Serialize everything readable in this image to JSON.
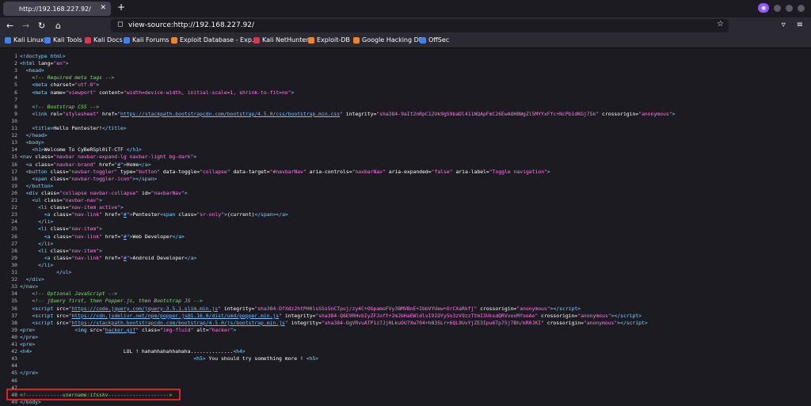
{
  "tab": {
    "title": "http://192.168.227.92/"
  },
  "url": "view-source:http://192.168.227.92/",
  "bookmarks": [
    "Kali Linux",
    "Kali Tools",
    "Kali Docs",
    "Kali Forums",
    "Exploit Database - Exp...",
    "Kali NetHunter",
    "Exploit-DB",
    "Google Hacking DB",
    "OffSec"
  ],
  "source_lines": [
    {
      "n": "1",
      "html": "<span class=\"t\">&lt;!doctype html&gt;</span>"
    },
    {
      "n": "2",
      "html": "<span class=\"t\">&lt;html</span> <span class=\"a\">lang</span>=<span class=\"v\">\"en\"</span><span class=\"t\">&gt;</span>"
    },
    {
      "n": "3",
      "html": "  <span class=\"t\">&lt;head&gt;</span>"
    },
    {
      "n": "4",
      "html": "    <span class=\"c\">&lt;!-- Required meta tags --&gt;</span>"
    },
    {
      "n": "5",
      "html": "    <span class=\"t\">&lt;meta</span> <span class=\"a\">charset</span>=<span class=\"v\">\"utf-8\"</span><span class=\"t\">&gt;</span>"
    },
    {
      "n": "6",
      "html": "    <span class=\"t\">&lt;meta</span> <span class=\"a\">name</span>=<span class=\"v\">\"viewport\"</span> <span class=\"a\">content</span>=<span class=\"v\">\"width=device-width, initial-scale=1, shrink-to-fit=no\"</span><span class=\"t\">&gt;</span>"
    },
    {
      "n": "7",
      "html": ""
    },
    {
      "n": "8",
      "html": "    <span class=\"c\">&lt;!-- Bootstrap CSS --&gt;</span>"
    },
    {
      "n": "9",
      "html": "    <span class=\"t\">&lt;link</span> <span class=\"a\">rel</span>=<span class=\"v\">\"stylesheet\"</span> <span class=\"a\">href</span>=<span class=\"v\">\"</span><span class=\"l\">https://stackpath.bootstrapcdn.com/bootstrap/4.5.0/css/bootstrap.min.css</span><span class=\"v\">\"</span> <span class=\"a\">integrity</span>=<span class=\"v\">\"sha384-9aIt2nRpC12Uk9gS9baDl411NQApFmC26EwAOH8WgZl5MYYxFfc+NcPb1dKGj7Sk\"</span> <span class=\"a\">crossorigin</span>=<span class=\"v\">\"anonymous\"</span><span class=\"t\">&gt;</span>"
    },
    {
      "n": "10",
      "html": ""
    },
    {
      "n": "11",
      "html": "    <span class=\"t\">&lt;title&gt;</span>Hello Pentester!<span class=\"t\">&lt;/title&gt;</span>"
    },
    {
      "n": "12",
      "html": "  <span class=\"t\">&lt;/head&gt;</span>"
    },
    {
      "n": "13",
      "html": "  <span class=\"t\">&lt;body&gt;</span>"
    },
    {
      "n": "14",
      "html": "    <span class=\"t\">&lt;h1&gt;</span>Welcome To CyBeRSpl0iT-CTF <span class=\"t\">&lt;/h1&gt;</span>"
    },
    {
      "n": "15",
      "html": "<span class=\"t\">&lt;nav</span> <span class=\"a\">class</span>=<span class=\"v\">\"navbar navbar-expand-lg navbar-light bg-dark\"</span><span class=\"t\">&gt;</span>"
    },
    {
      "n": "16",
      "html": "  <span class=\"t\">&lt;a</span> <span class=\"a\">class</span>=<span class=\"v\">\"navbar-brand\"</span> <span class=\"a\">href</span>=<span class=\"v\">\"</span><span class=\"l\">#</span><span class=\"v\">\"</span><span class=\"t\">&gt;</span>Home<span class=\"t\">&lt;/a&gt;</span>"
    },
    {
      "n": "17",
      "html": "  <span class=\"t\">&lt;button</span> <span class=\"a\">class</span>=<span class=\"v\">\"navbar-toggler\"</span> <span class=\"a\">type</span>=<span class=\"v\">\"button\"</span> <span class=\"a\">data-toggle</span>=<span class=\"v\">\"collapse\"</span> <span class=\"a\">data-target</span>=<span class=\"v\">\"#navbarNav\"</span> <span class=\"a\">aria-controls</span>=<span class=\"v\">\"navbarNav\"</span> <span class=\"a\">aria-expanded</span>=<span class=\"v\">\"false\"</span> <span class=\"a\">aria-label</span>=<span class=\"v\">\"Toggle navigation\"</span><span class=\"t\">&gt;</span>"
    },
    {
      "n": "18",
      "html": "    <span class=\"t\">&lt;span</span> <span class=\"a\">class</span>=<span class=\"v\">\"navbar-toggler-icon\"</span><span class=\"t\">&gt;&lt;/span&gt;</span>"
    },
    {
      "n": "19",
      "html": "  <span class=\"t\">&lt;/button&gt;</span>"
    },
    {
      "n": "20",
      "html": "  <span class=\"t\">&lt;div</span> <span class=\"a\">class</span>=<span class=\"v\">\"collapse navbar-collapse\"</span> <span class=\"a\">id</span>=<span class=\"v\">\"navbarNav\"</span><span class=\"t\">&gt;</span>"
    },
    {
      "n": "21",
      "html": "    <span class=\"t\">&lt;ul</span> <span class=\"a\">class</span>=<span class=\"v\">\"navbar-nav\"</span><span class=\"t\">&gt;</span>"
    },
    {
      "n": "22",
      "html": "      <span class=\"t\">&lt;li</span> <span class=\"a\">class</span>=<span class=\"v\">\"nav-item active\"</span><span class=\"t\">&gt;</span>"
    },
    {
      "n": "23",
      "html": "        <span class=\"t\">&lt;a</span> <span class=\"a\">class</span>=<span class=\"v\">\"nav-link\"</span> <span class=\"a\">href</span>=<span class=\"v\">\"</span><span class=\"l\">#</span><span class=\"v\">\"</span><span class=\"t\">&gt;</span>Pentester<span class=\"t\">&lt;span</span> <span class=\"a\">class</span>=<span class=\"v\">\"sr-only\"</span><span class=\"t\">&gt;</span>(current)<span class=\"t\">&lt;/span&gt;&lt;/a&gt;</span>"
    },
    {
      "n": "24",
      "html": "      <span class=\"t\">&lt;/li&gt;</span>"
    },
    {
      "n": "25",
      "html": "      <span class=\"t\">&lt;li</span> <span class=\"a\">class</span>=<span class=\"v\">\"nav-item\"</span><span class=\"t\">&gt;</span>"
    },
    {
      "n": "26",
      "html": "        <span class=\"t\">&lt;a</span> <span class=\"a\">class</span>=<span class=\"v\">\"nav-link\"</span> <span class=\"a\">href</span>=<span class=\"v\">\"</span><span class=\"l\">#</span><span class=\"v\">\"</span><span class=\"t\">&gt;</span>Web Developer<span class=\"t\">&lt;/a&gt;</span>"
    },
    {
      "n": "27",
      "html": "      <span class=\"t\">&lt;/li&gt;</span>"
    },
    {
      "n": "28",
      "html": "      <span class=\"t\">&lt;li</span> <span class=\"a\">class</span>=<span class=\"v\">\"nav-item\"</span><span class=\"t\">&gt;</span>"
    },
    {
      "n": "29",
      "html": "        <span class=\"t\">&lt;a</span> <span class=\"a\">class</span>=<span class=\"v\">\"nav-link\"</span> <span class=\"a\">href</span>=<span class=\"v\">\"</span><span class=\"l\">#</span><span class=\"v\">\"</span><span class=\"t\">&gt;</span>Android Developer<span class=\"t\">&lt;/a&gt;</span>"
    },
    {
      "n": "30",
      "html": "      <span class=\"t\">&lt;/li&gt;</span>"
    },
    {
      "n": "31",
      "html": "            <span class=\"t\">&lt;/ul&gt;</span>"
    },
    {
      "n": "32",
      "html": "  <span class=\"t\">&lt;/div&gt;</span>"
    },
    {
      "n": "33",
      "html": "<span class=\"t\">&lt;/nav&gt;</span>"
    },
    {
      "n": "34",
      "html": "    <span class=\"c\">&lt;!-- Optional JavaScript --&gt;</span>"
    },
    {
      "n": "35",
      "html": "    <span class=\"c\">&lt;!-- jQuery first, then Popper.js, then Bootstrap JS --&gt;</span>"
    },
    {
      "n": "36",
      "html": "    <span class=\"t\">&lt;script</span> <span class=\"a\">src</span>=<span class=\"v\">\"</span><span class=\"l\">https://code.jquery.com/jquery-3.5.1.slim.min.js</span><span class=\"v\">\"</span> <span class=\"a\">integrity</span>=<span class=\"v\">\"sha384-DfXdz2htPH0lsSSs5nCTpuj/zy4C+OGpamoFVy38MVBnE+IbbVYUew+OrCXaRkfj\"</span> <span class=\"a\">crossorigin</span>=<span class=\"v\">\"anonymous\"</span><span class=\"t\">&gt;&lt;/script&gt;</span>"
    },
    {
      "n": "37",
      "html": "    <span class=\"t\">&lt;script</span> <span class=\"a\">src</span>=<span class=\"v\">\"</span><span class=\"l\">https://cdn.jsdelivr.net/npm/popper.js@1.16.0/dist/umd/popper.min.js</span><span class=\"v\">\"</span> <span class=\"a\">integrity</span>=<span class=\"v\">\"sha384-Q6E9RHvbIyZFJoft+2mJbHaEWldlvI9IOYy5n3zV9zzTtmI3UksdQRVvoxMfooAo\"</span> <span class=\"a\">crossorigin</span>=<span class=\"v\">\"anonymous\"</span><span class=\"t\">&gt;&lt;/script&gt;</span>"
    },
    {
      "n": "38",
      "html": "    <span class=\"t\">&lt;script</span> <span class=\"a\">src</span>=<span class=\"v\">\"</span><span class=\"l\">https://stackpath.bootstrapcdn.com/bootstrap/4.5.0/js/bootstrap.min.js</span><span class=\"v\">\"</span> <span class=\"a\">integrity</span>=<span class=\"v\">\"sha384-OgVRvuATP1z7JjHLkuOU7Xw704+h835Lr+6QL9UvYjZE3Ipu6Tp75j7Bh/kR0JKI\"</span> <span class=\"a\">crossorigin</span>=<span class=\"v\">\"anonymous\"</span><span class=\"t\">&gt;&lt;/script&gt;</span>"
    },
    {
      "n": "39",
      "html": "<span class=\"t\">&lt;pre&gt;</span>             <span class=\"t\">&lt;img</span> <span class=\"a\">src</span>=<span class=\"v\">\"</span><span class=\"l\">hacker.gif</span><span class=\"v\">\"</span> <span class=\"a\">class</span>=<span class=\"v\">\"img-fluid\"</span> <span class=\"a\">alt</span>=<span class=\"v\">\"hacker\"</span><span class=\"t\">&gt;</span>"
    },
    {
      "n": "40",
      "html": "<span class=\"t\">&lt;/pre&gt;</span>"
    },
    {
      "n": "41",
      "html": "<span class=\"t\">&lt;pre&gt;</span>"
    },
    {
      "n": "42",
      "html": "<span class=\"t\">&lt;h4&gt;</span>                              LOL ! hahahhahahhahaha..............<span class=\"t\">&lt;h4&gt;</span>"
    },
    {
      "n": "43",
      "html": "                                                         <span class=\"t\">&lt;h5&gt;</span> You should try something more ! <span class=\"t\">&lt;h5&gt;</span>"
    },
    {
      "n": "44",
      "html": ""
    },
    {
      "n": "45",
      "html": "<span class=\"t\">&lt;/pre&gt;</span>"
    },
    {
      "n": "46",
      "html": ""
    },
    {
      "n": "47",
      "html": ""
    },
    {
      "n": "48",
      "html": "<span class=\"c\">&lt;!------------username:itsskv--------------------&gt;</span>"
    },
    {
      "n": "49",
      "html": "<span class=\"t\">&lt;/body&gt;</span>"
    }
  ]
}
